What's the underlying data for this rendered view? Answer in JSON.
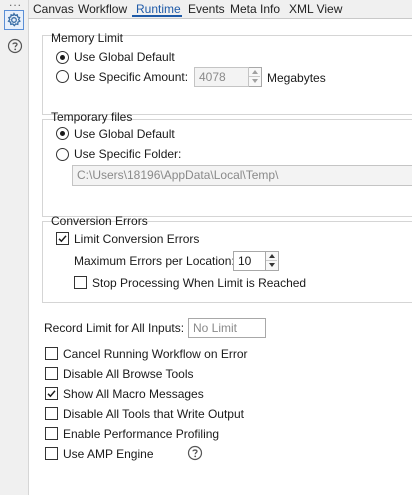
{
  "tabs": [
    "Canvas",
    "Workflow",
    "Runtime",
    "Events",
    "Meta Info",
    "XML View"
  ],
  "active_tab": "Runtime",
  "accent_color": "#1e5aa8",
  "left_icons": [
    "more-dots-icon",
    "gear-icon",
    "help-circle-icon"
  ],
  "more_dots": "...",
  "memory_limit": {
    "title": "Memory Limit",
    "option_global": "Use Global Default",
    "option_specific": "Use Specific Amount:",
    "selected": "Use Global Default",
    "amount_value": "4078",
    "unit": "Megabytes"
  },
  "temporary_files": {
    "title": "Temporary files",
    "option_global": "Use Global Default",
    "option_specific": "Use Specific Folder:",
    "selected": "Use Global Default",
    "folder_value": "C:\\Users\\18196\\AppData\\Local\\Temp\\"
  },
  "conversion_errors": {
    "title": "Conversion Errors",
    "limit_label": "Limit Conversion Errors",
    "limit_checked": true,
    "max_label": "Maximum Errors per Location:",
    "max_value": "10",
    "stop_label": "Stop Processing When Limit is Reached",
    "stop_checked": false
  },
  "record_limit": {
    "label": "Record Limit for All Inputs:",
    "placeholder": "No Limit"
  },
  "options": [
    {
      "label": "Cancel Running Workflow on Error",
      "checked": false
    },
    {
      "label": "Disable All Browse Tools",
      "checked": false
    },
    {
      "label": "Show All Macro Messages",
      "checked": true
    },
    {
      "label": "Disable All Tools that Write Output",
      "checked": false
    },
    {
      "label": "Enable Performance Profiling",
      "checked": false
    },
    {
      "label": "Use AMP Engine",
      "checked": false
    }
  ]
}
